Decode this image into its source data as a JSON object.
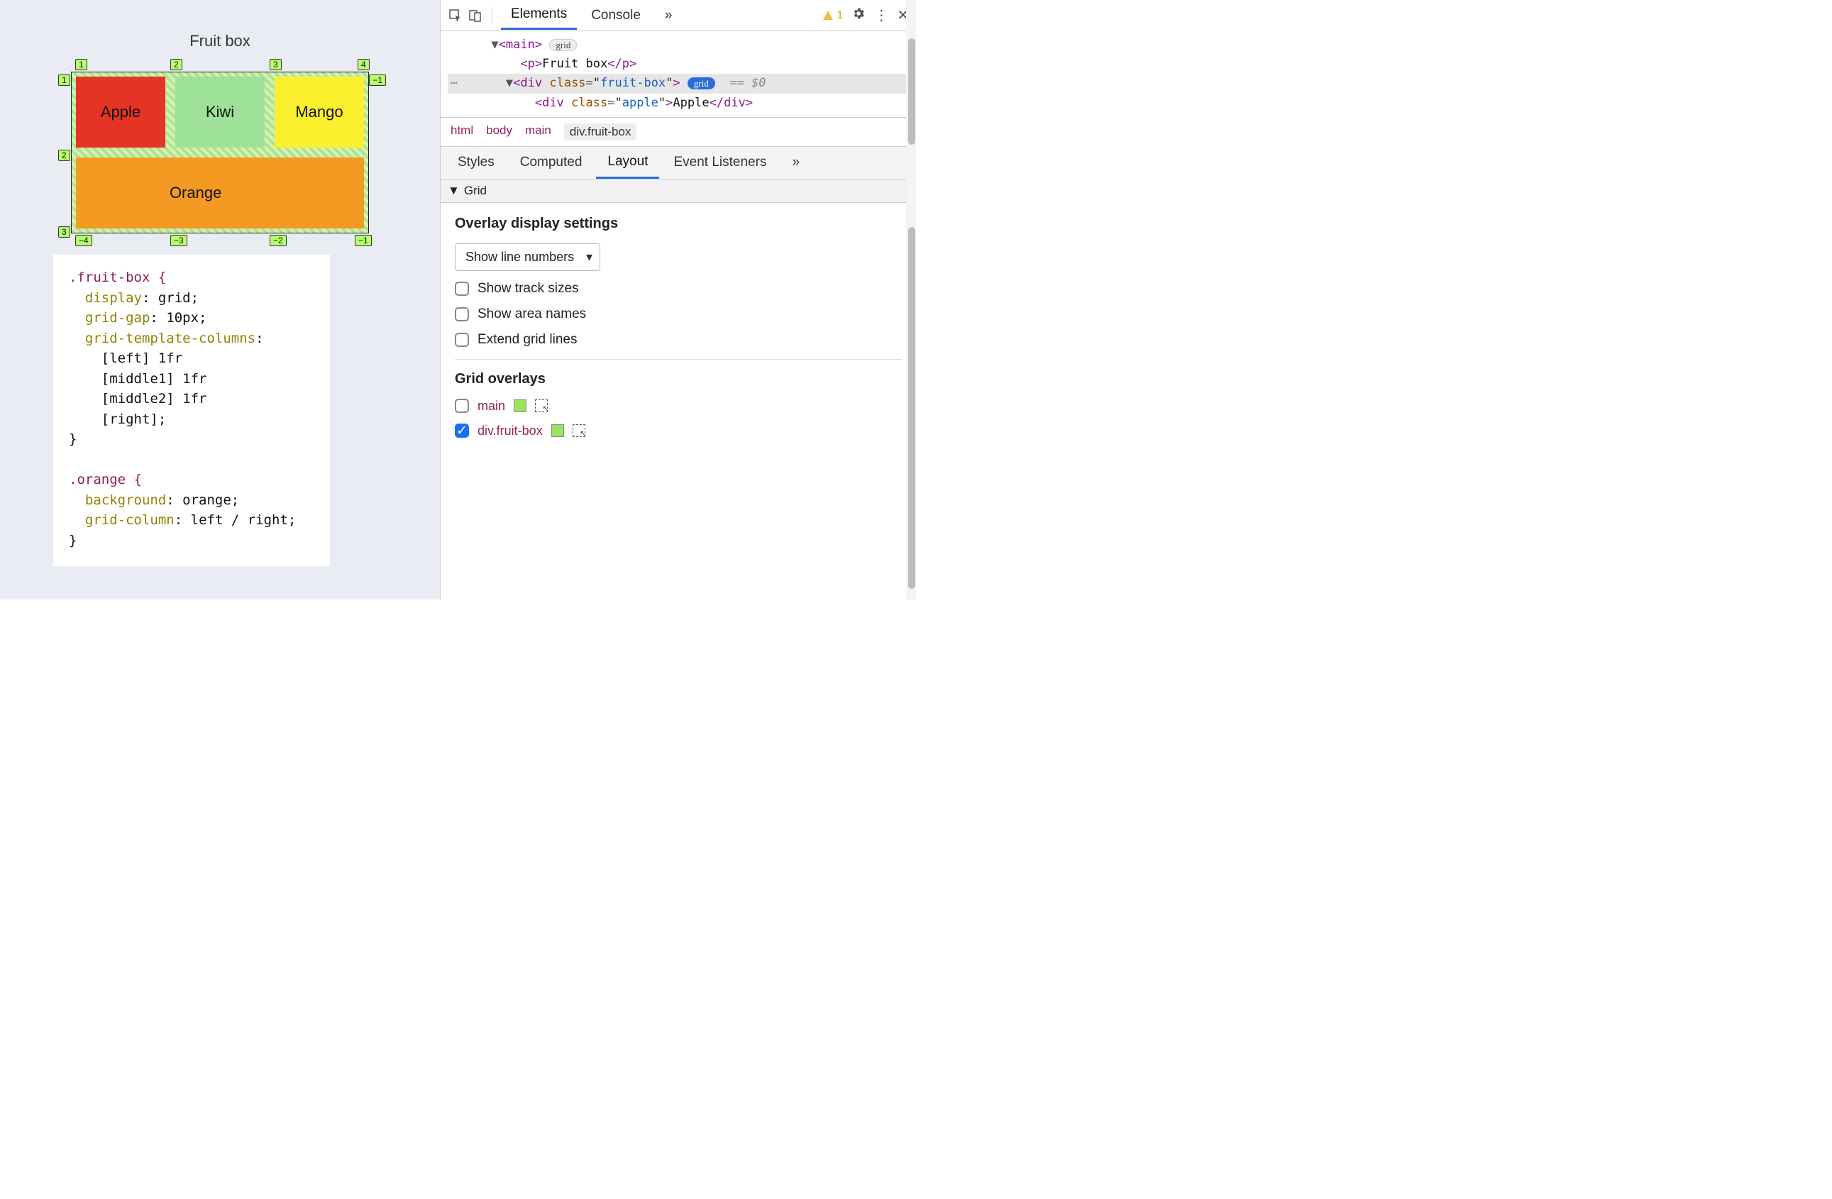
{
  "preview": {
    "title": "Fruit box",
    "cells": {
      "apple": "Apple",
      "kiwi": "Kiwi",
      "mango": "Mango",
      "orange": "Orange"
    },
    "lineNumbers": {
      "top": [
        "1",
        "2",
        "3",
        "4"
      ],
      "leftOut": [
        "1",
        "2",
        "3"
      ],
      "rightOut": [
        "−1"
      ],
      "bottom": [
        "−4",
        "−3",
        "−2",
        "−1"
      ]
    },
    "css": {
      "rule1_sel": ".fruit-box {",
      "rule1_l1_p": "display",
      "rule1_l1_v": "grid;",
      "rule1_l2_p": "grid-gap",
      "rule1_l2_v": "10px;",
      "rule1_l3_p": "grid-template-columns",
      "rule1_l3_v": ":",
      "rule1_l4": "[left] 1fr",
      "rule1_l5": "[middle1] 1fr",
      "rule1_l6": "[middle2] 1fr",
      "rule1_l7": "[right];",
      "rule1_close": "}",
      "rule2_sel": ".orange {",
      "rule2_l1_p": "background",
      "rule2_l1_v": "orange;",
      "rule2_l2_p": "grid-column",
      "rule2_l2_v": "left / right;",
      "rule2_close": "}"
    }
  },
  "devtools": {
    "tabs": {
      "elements": "Elements",
      "console": "Console",
      "more": "»"
    },
    "warnCount": "1",
    "dom": {
      "main_open": "<main>",
      "main_badge": "grid",
      "p_open": "<p>",
      "p_text": "Fruit box",
      "p_close": "</p>",
      "div_open_tag": "div",
      "div_attr": "class",
      "div_val": "fruit-box",
      "div_badge": "grid",
      "div_suffix": "== $0",
      "inner_tag": "div",
      "inner_attr": "class",
      "inner_val": "apple",
      "inner_text": "Apple",
      "inner_close": "</div>"
    },
    "crumbs": [
      "html",
      "body",
      "main",
      "div.fruit-box"
    ],
    "subtabs": {
      "styles": "Styles",
      "computed": "Computed",
      "layout": "Layout",
      "listeners": "Event Listeners",
      "more": "»"
    },
    "gridSection": "Grid",
    "overlayTitle": "Overlay display settings",
    "selectLabel": "Show line numbers",
    "options": {
      "trackSizes": "Show track sizes",
      "areaNames": "Show area names",
      "extend": "Extend grid lines"
    },
    "overlaysTitle": "Grid overlays",
    "overlays": [
      {
        "name": "main",
        "checked": false
      },
      {
        "name": "div.fruit-box",
        "checked": true
      }
    ]
  }
}
